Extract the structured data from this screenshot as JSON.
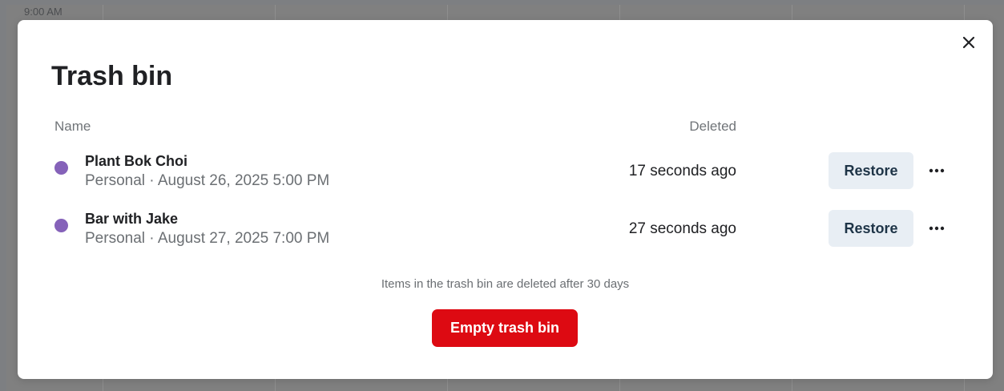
{
  "background": {
    "time_label": "9:00 AM"
  },
  "modal": {
    "title": "Trash bin",
    "close_icon": "close-icon",
    "columns": {
      "name": "Name",
      "deleted": "Deleted"
    },
    "items": [
      {
        "title": "Plant Bok Choi",
        "meta": "Personal · August 26, 2025 5:00 PM",
        "deleted": "17 seconds ago",
        "restore_label": "Restore",
        "color": "#8562b9"
      },
      {
        "title": "Bar with Jake",
        "meta": "Personal · August 27, 2025 7:00 PM",
        "deleted": "27 seconds ago",
        "restore_label": "Restore",
        "color": "#8562b9"
      }
    ],
    "footer_note": "Items in the trash bin are deleted after 30 days",
    "empty_button_label": "Empty trash bin",
    "colors": {
      "danger": "#dd0a12",
      "restore_bg": "#e8eef4",
      "event_dot": "#8562b9"
    }
  }
}
